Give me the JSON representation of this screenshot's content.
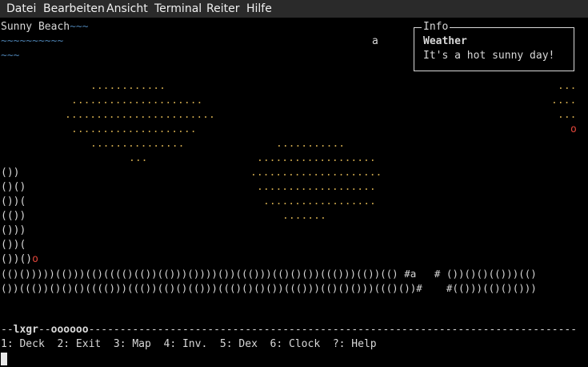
{
  "menubar": {
    "items": [
      "Datei",
      "Bearbeiten",
      "Ansicht",
      "Terminal",
      "Reiter",
      "Hilfe"
    ]
  },
  "terminal": {
    "title": "Sunny Beach",
    "title_waves": "~~~",
    "wave_row_1": "~~~~~~~~~~",
    "wave_row_2": "~~~",
    "creature_a": "a",
    "sand_rows": [
      "............",
      ".....................",
      "........................",
      "....................",
      "...............",
      "...",
      "...........",
      "...................",
      ".....................",
      "...................",
      "..................",
      ".......",
      "...",
      "....",
      "..."
    ],
    "red_marker_1": "o",
    "rock_rows": [
      "())",
      "()()",
      "())(",
      "(())",
      "()))",
      "())(",
      "())()"
    ],
    "red_marker_2": "o",
    "shore_row_1_left": "(()()))))(()))(()(((()(())(()))())))())((()))(()()())((()))(())(()",
    "shore_row_1_mid": " #a   # ",
    "shore_row_1_right": "())()()(()))(()",
    "shore_row_2_left": "())((())()()()(((()))((())(()()(()))((()()()())((()))(()()()))((()())#",
    "shore_row_2_mid": "    #",
    "shore_row_2_right": "(()))(()()()))",
    "status_name": "lxgr",
    "status_extra": "oooooo",
    "status_fill": "------------------------------------------------------------------------------",
    "hotkeys": "1: Deck  2: Exit  3: Map  4: Inv.  5: Dex  6: Clock  ?: Help"
  },
  "info": {
    "title": "Info",
    "heading": "Weather",
    "text": "It's a hot sunny day!"
  },
  "colors": {
    "sand": "#c6a24a",
    "water": "#4b7fae",
    "marker": "#e0453a"
  }
}
